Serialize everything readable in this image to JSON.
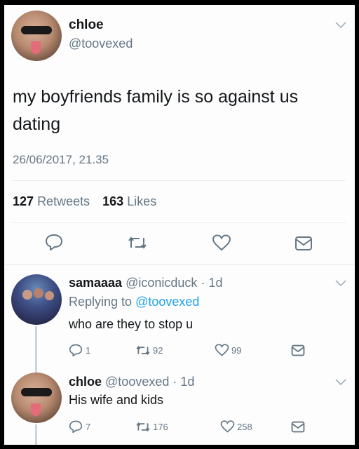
{
  "tweet": {
    "name": "chloe",
    "handle": "@toovexed",
    "text": "my boyfriends family is so against us dating",
    "timestamp": "26/06/2017, 21.35",
    "retweets_count": "127",
    "retweets_label": "Retweets",
    "likes_count": "163",
    "likes_label": "Likes"
  },
  "replies": [
    {
      "name": "samaaaa",
      "handle": "@iconicduck",
      "time": "· 1d",
      "replying_prefix": "Replying to",
      "replying_handle": "@toovexed",
      "text": "who are they to stop u",
      "reply_count": "1",
      "retweet_count": "92",
      "like_count": "99"
    },
    {
      "name": "chloe",
      "handle": "@toovexed",
      "time": "· 1d",
      "text": "His wife and kids",
      "reply_count": "7",
      "retweet_count": "176",
      "like_count": "258"
    }
  ],
  "colors": {
    "accent": "#1da1f2",
    "muted": "#657786",
    "text": "#14171a"
  },
  "icons": [
    "chevron-down-icon",
    "reply-icon",
    "retweet-icon",
    "like-icon",
    "message-icon"
  ]
}
